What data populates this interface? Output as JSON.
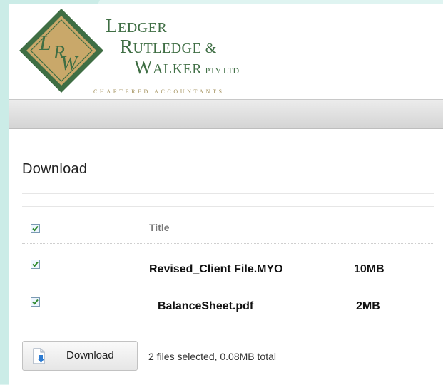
{
  "colors": {
    "brand_green": "#3f6e44",
    "logo_gold": "#c9a86a",
    "checkbox_check": "#2f8a2f"
  },
  "logo": {
    "monogram": "LRW",
    "line1": {
      "initial": "L",
      "rest": "EDGER"
    },
    "line2": {
      "initial": "R",
      "rest": "UTLEDGE &"
    },
    "line3": {
      "initial": "W",
      "rest": "ALKER",
      "suffix": "PTY LTD"
    },
    "subtitle": "CHARTERED ACCOUNTANTS"
  },
  "page": {
    "title": "Download"
  },
  "table": {
    "header": {
      "checked": true,
      "title": "Title"
    },
    "rows": [
      {
        "checked": true,
        "name": "Revised_Client File.MYO",
        "size": "10MB"
      },
      {
        "checked": true,
        "name": "BalanceSheet.pdf",
        "size": "2MB"
      }
    ]
  },
  "footer": {
    "download_button_label": "Download",
    "download_icon": "document-download-icon",
    "status_text": "2 files selected, 0.08MB total"
  }
}
